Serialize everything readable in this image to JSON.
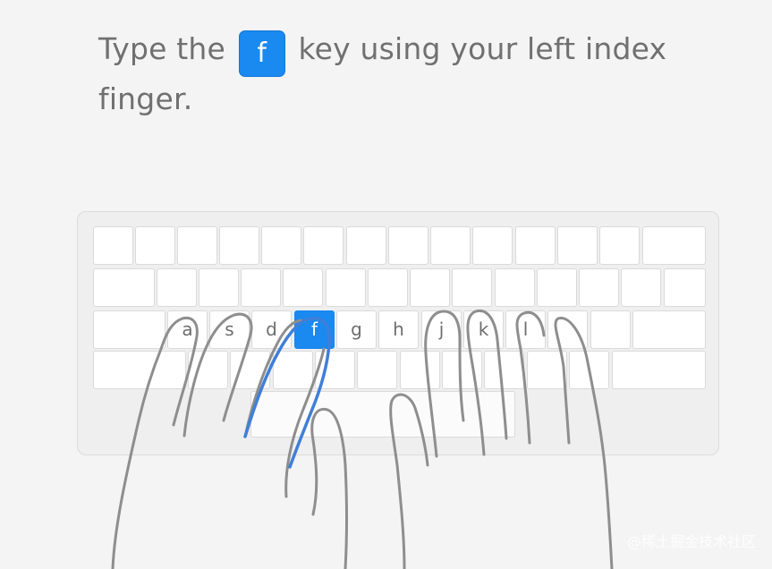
{
  "instruction": {
    "prefix": "Type the",
    "key": "f",
    "suffix": "key using your left index finger."
  },
  "keyboard": {
    "home_row_keys": [
      "a",
      "s",
      "d",
      "f",
      "g",
      "h",
      "j",
      "k",
      "l"
    ],
    "active_key": "f",
    "accent_color": "#1a89f0"
  },
  "watermark": "@稀土掘金技术社区"
}
